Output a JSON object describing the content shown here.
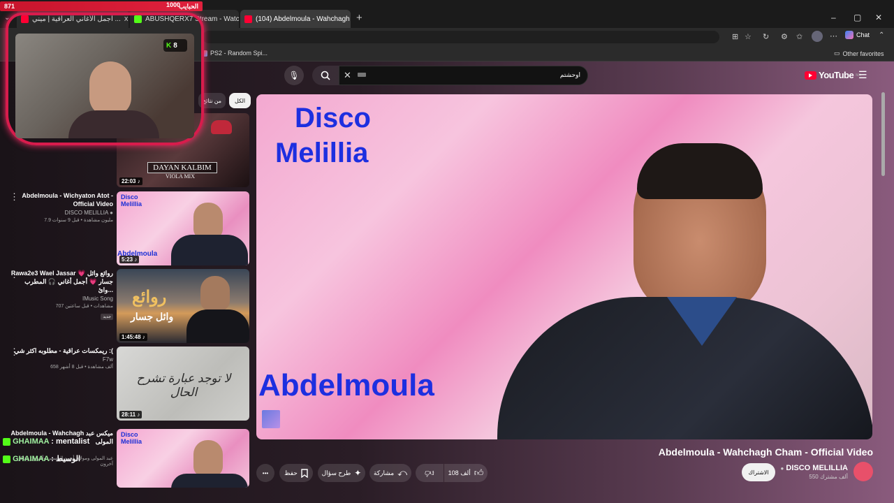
{
  "overlay": {
    "hp_left": "871",
    "hp_right": "1000",
    "hp_label": "الحبايب",
    "kick_count": "8"
  },
  "tabs": [
    {
      "label": "أجمل الأغاني العراقية | ميني ...",
      "x": "x"
    },
    {
      "label": "ABUSHQERX7 Stream - Watch Live ...",
      "x": "x"
    },
    {
      "label": "(104) Abdelmoula - Wahchagh Ch...",
      "x": "x"
    }
  ],
  "browser": {
    "new_tab": "+",
    "fav_item": "PS2 - Random Spi...",
    "other_favorites": "Other favorites",
    "chat": "Chat",
    "win_min": "–",
    "win_max": "▢",
    "win_close": "✕"
  },
  "search": {
    "query": "اوحشتم",
    "placeholder": ""
  },
  "logo": {
    "text": "YouTube",
    "region": "MA"
  },
  "chips": {
    "all": "الكل",
    "from_results": "من نتائج"
  },
  "sidebar": [
    {
      "title": "",
      "channel": "",
      "stats": "",
      "duration": "22:03",
      "thumb_text": "DAYAN KALBIM",
      "thumb_sub": "VIOLA MIX"
    },
    {
      "title": "Abdelmoula - Wichyaton Atot - Official Video",
      "channel": "DISCO MELILLIA",
      "stats": "7.9 مليون مشاهدة • قبل 9 سنوات",
      "duration": "5:23",
      "thumb_text": "Disco Melillia",
      "thumb_sub": "Abdelmoula"
    },
    {
      "title": "Rawa2e3 Wael Jassar 💗 روائع وائل جسار 💗 أجمل أغاني 🎧 المطرب وائ...",
      "channel": "IMusic Song",
      "stats": "707 مشاهدات • قبل ساعتين",
      "badge": "جديد",
      "duration": "1:45:48",
      "thumb_text": "روائع",
      "thumb_sub": "وائل جسار"
    },
    {
      "title": "ريمكسات عراقية - مطلوبه اكثر شي :(",
      "channel": "F7w",
      "stats": "658 ألف مشاهدة • قبل 8 أشهر",
      "duration": "28:11",
      "thumb_text": "لا توجد عبارة تشرح الحال",
      "thumb_sub": ""
    },
    {
      "title": "Abdelmoula - Wahchagh ميكس عبد المولى",
      "channel": "",
      "stats": "عبد المولى ومولاي أحمد الحسني وآخرون وفاكر آخرون",
      "duration": "",
      "thumb_text": "Disco Melillia",
      "thumb_sub": ""
    }
  ],
  "chat": [
    {
      "user": "GHAIMAA",
      "msg": ": mentalist"
    },
    {
      "user": "GHAIMAA",
      "msg": ": الوسيط"
    }
  ],
  "player": {
    "line1": "Disco",
    "line2": "Melillia",
    "bottom": "Abdelmoula"
  },
  "video": {
    "title": "Abdelmoula - Wahchagh Cham - Official Video",
    "channel": "DISCO MELILLIA",
    "subs": "550 ألف مشترك",
    "subscribe": "الاشتراك",
    "likes": "108 ألف",
    "share": "مشاركة",
    "ask": "طرح سؤال",
    "save": "حفظ",
    "more": "•••"
  },
  "colors": {
    "brand": "#ff0033",
    "kick": "#53fc18",
    "overlay_red": "#e0213d"
  }
}
